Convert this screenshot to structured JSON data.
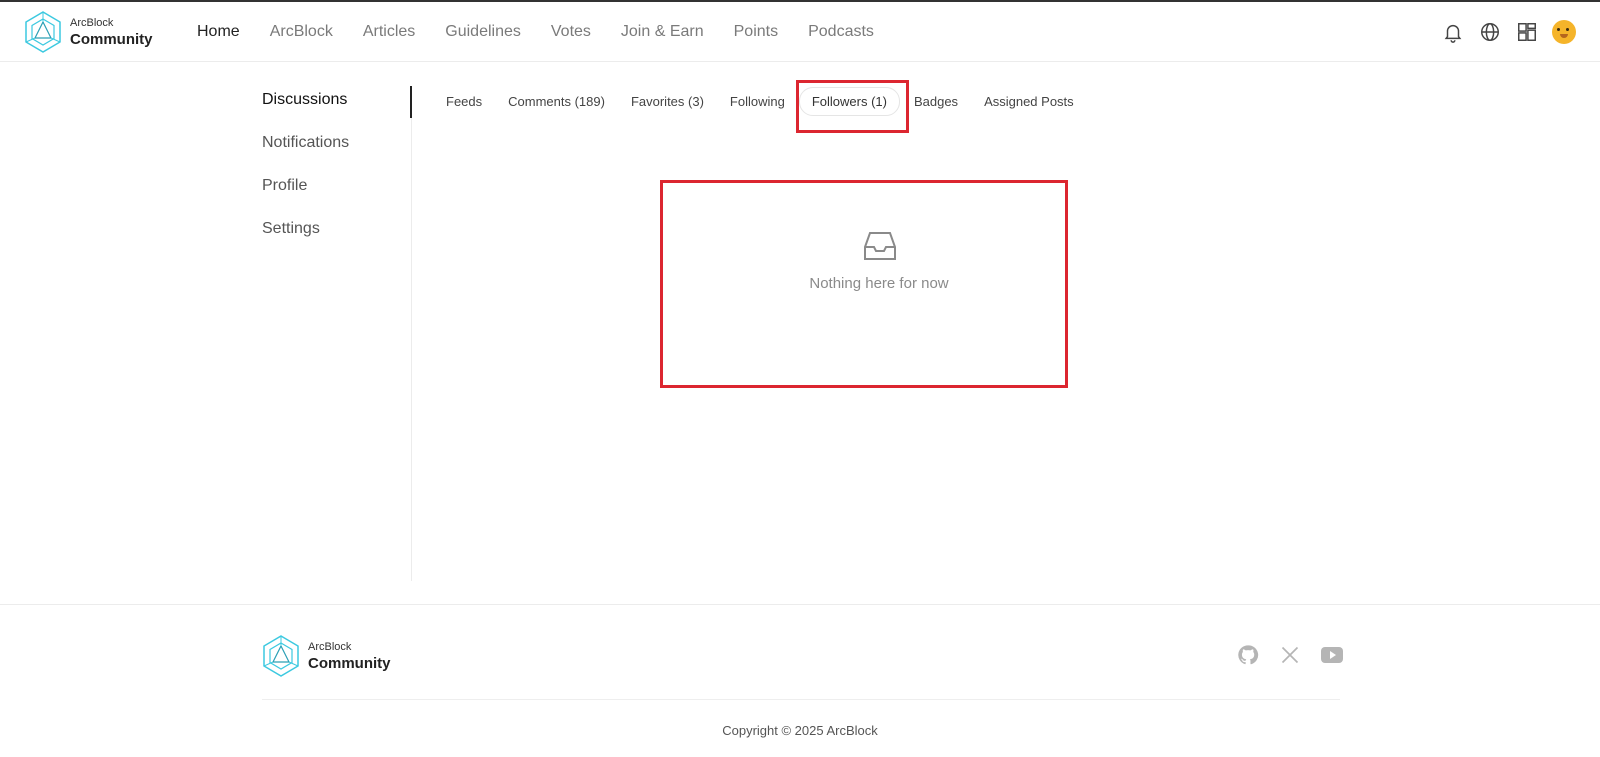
{
  "brand": {
    "top": "ArcBlock",
    "bottom": "Community",
    "accent": "#3cc9e0"
  },
  "nav": {
    "items": [
      {
        "label": "Home",
        "active": true
      },
      {
        "label": "ArcBlock"
      },
      {
        "label": "Articles"
      },
      {
        "label": "Guidelines"
      },
      {
        "label": "Votes"
      },
      {
        "label": "Join & Earn"
      },
      {
        "label": "Points"
      },
      {
        "label": "Podcasts"
      }
    ]
  },
  "header_icons": [
    "bell-icon",
    "globe-icon",
    "apps-grid-icon",
    "avatar"
  ],
  "sidebar": {
    "items": [
      {
        "label": "Discussions",
        "active": true
      },
      {
        "label": "Notifications"
      },
      {
        "label": "Profile"
      },
      {
        "label": "Settings"
      }
    ]
  },
  "tabs": [
    {
      "label": "Feeds"
    },
    {
      "label": "Comments (189)"
    },
    {
      "label": "Favorites (3)"
    },
    {
      "label": "Following"
    },
    {
      "label": "Followers (1)",
      "active": true
    },
    {
      "label": "Badges"
    },
    {
      "label": "Assigned Posts"
    }
  ],
  "empty": {
    "icon": "inbox-icon",
    "text": "Nothing here for now"
  },
  "highlight_color": "#dc2630",
  "footer": {
    "social": [
      "github-icon",
      "x-icon",
      "youtube-icon"
    ],
    "copyright": "Copyright © 2025 ArcBlock"
  }
}
